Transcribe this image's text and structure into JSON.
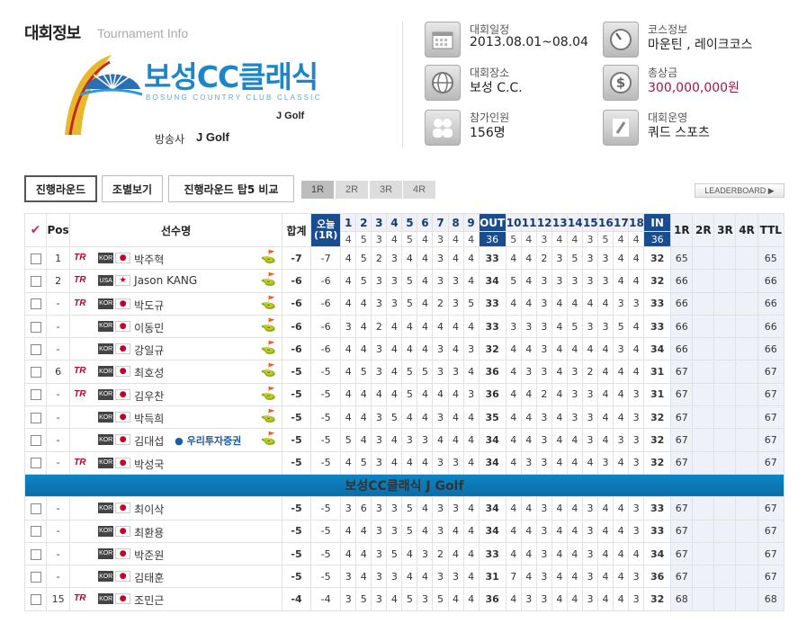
{
  "header": {
    "title": "대회정보",
    "subtitle": "Tournament Info"
  },
  "logo": {
    "name": "보성CC클래식",
    "english": "BOSUNG COUNTRY CLUB CLASSIC",
    "series": "J Golf"
  },
  "broadcast": {
    "label": "방송사",
    "logo_text": "J Golf"
  },
  "info": [
    {
      "icon": "calendar-icon",
      "label": "대회일정",
      "value": "2013.08.01~08.04"
    },
    {
      "icon": "compass-icon",
      "label": "코스정보",
      "value": "마운틴 , 레이크코스"
    },
    {
      "icon": "globe-icon",
      "label": "대회장소",
      "value": "보성 C.C."
    },
    {
      "icon": "dollar-icon",
      "label": "총상금",
      "value": "300,000,000원"
    },
    {
      "icon": "players-icon",
      "label": "참가인원",
      "value": "156명"
    },
    {
      "icon": "operator-icon",
      "label": "대회운영",
      "value": "쿼드 스포츠"
    }
  ],
  "tabs": [
    "진행라운드",
    "조별보기",
    "진행라운드 탑5 비교"
  ],
  "rounds": [
    "1R",
    "2R",
    "3R",
    "4R"
  ],
  "leaderboard_button": "LEADERBOARD ▶",
  "table": {
    "headers": {
      "pos": "Pos",
      "name": "선수명",
      "total": "합계",
      "today": "오늘(1R)",
      "out": "OUT",
      "in": "IN",
      "r1": "1R",
      "r2": "2R",
      "r3": "3R",
      "r4": "4R",
      "ttl": "TTL"
    },
    "holes": [
      "1",
      "2",
      "3",
      "4",
      "5",
      "6",
      "7",
      "8",
      "9",
      "10",
      "11",
      "12",
      "13",
      "14",
      "15",
      "16",
      "17",
      "18"
    ],
    "par": [
      4,
      5,
      3,
      4,
      5,
      4,
      3,
      4,
      4,
      5,
      4,
      3,
      4,
      4,
      3,
      5,
      4,
      4
    ],
    "par_out": "36",
    "par_in": "36",
    "rows": [
      {
        "pos": "1",
        "tr": true,
        "flag": "KOR",
        "name": "박주혁",
        "club": true,
        "total": "-7",
        "today": "-7",
        "h": [
          4,
          5,
          2,
          3,
          4,
          4,
          3,
          4,
          4
        ],
        "out": "33",
        "h2": [
          4,
          4,
          2,
          3,
          5,
          3,
          3,
          4,
          4
        ],
        "in": "32",
        "r1": "65",
        "ttl": "65"
      },
      {
        "pos": "2",
        "tr": true,
        "flag": "USA",
        "name": "Jason KANG",
        "club": true,
        "total": "-6",
        "today": "-6",
        "h": [
          4,
          5,
          3,
          3,
          5,
          4,
          3,
          3,
          4
        ],
        "out": "34",
        "h2": [
          5,
          4,
          3,
          3,
          3,
          3,
          3,
          4,
          4
        ],
        "in": "32",
        "r1": "66",
        "ttl": "66"
      },
      {
        "pos": "-",
        "tr": true,
        "flag": "KOR",
        "name": "박도규",
        "club": true,
        "total": "-6",
        "today": "-6",
        "h": [
          4,
          4,
          3,
          3,
          5,
          4,
          2,
          3,
          5
        ],
        "out": "33",
        "h2": [
          4,
          4,
          3,
          4,
          4,
          4,
          4,
          3,
          3
        ],
        "in": "33",
        "r1": "66",
        "ttl": "66"
      },
      {
        "pos": "-",
        "tr": false,
        "flag": "KOR",
        "name": "이동민",
        "club": true,
        "total": "-6",
        "today": "-6",
        "h": [
          3,
          4,
          2,
          4,
          4,
          4,
          4,
          4,
          4
        ],
        "out": "33",
        "h2": [
          3,
          3,
          3,
          4,
          5,
          3,
          3,
          5,
          4
        ],
        "in": "33",
        "r1": "66",
        "ttl": "66"
      },
      {
        "pos": "-",
        "tr": false,
        "flag": "KOR",
        "name": "강일규",
        "club": true,
        "total": "-6",
        "today": "-6",
        "h": [
          4,
          4,
          3,
          4,
          4,
          4,
          3,
          4,
          3
        ],
        "out": "32",
        "h2": [
          4,
          4,
          3,
          4,
          4,
          4,
          4,
          3,
          4
        ],
        "in": "34",
        "r1": "66",
        "ttl": "66"
      },
      {
        "pos": "6",
        "tr": true,
        "flag": "KOR",
        "name": "최호성",
        "club": true,
        "total": "-5",
        "today": "-5",
        "h": [
          4,
          5,
          3,
          4,
          5,
          5,
          3,
          3,
          4
        ],
        "out": "36",
        "h2": [
          4,
          3,
          3,
          4,
          3,
          2,
          4,
          4,
          4
        ],
        "in": "31",
        "r1": "67",
        "ttl": "67"
      },
      {
        "pos": "-",
        "tr": true,
        "flag": "KOR",
        "name": "김우찬",
        "club": true,
        "total": "-5",
        "today": "-5",
        "h": [
          4,
          4,
          4,
          4,
          5,
          4,
          4,
          4,
          3
        ],
        "out": "36",
        "h2": [
          4,
          4,
          2,
          4,
          3,
          3,
          4,
          4,
          3
        ],
        "in": "31",
        "r1": "67",
        "ttl": "67"
      },
      {
        "pos": "-",
        "tr": false,
        "flag": "KOR",
        "name": "박득희",
        "club": true,
        "total": "-5",
        "today": "-5",
        "h": [
          4,
          4,
          3,
          5,
          4,
          4,
          3,
          4,
          4
        ],
        "out": "35",
        "h2": [
          4,
          4,
          3,
          4,
          3,
          3,
          4,
          4,
          3
        ],
        "in": "32",
        "r1": "67",
        "ttl": "67"
      },
      {
        "pos": "-",
        "tr": false,
        "flag": "KOR",
        "name": "김대섭",
        "club": true,
        "sponsor": "● 우리투자증권",
        "total": "-5",
        "today": "-5",
        "h": [
          5,
          4,
          3,
          4,
          3,
          3,
          4,
          4,
          4
        ],
        "out": "34",
        "h2": [
          4,
          4,
          3,
          4,
          4,
          3,
          4,
          3,
          3
        ],
        "in": "32",
        "r1": "67",
        "ttl": "67"
      },
      {
        "pos": "-",
        "tr": true,
        "flag": "KOR",
        "name": "박성국",
        "club": false,
        "total": "-5",
        "today": "-5",
        "h": [
          4,
          5,
          3,
          4,
          4,
          4,
          3,
          3,
          4
        ],
        "out": "34",
        "h2": [
          4,
          3,
          3,
          4,
          4,
          4,
          3,
          4,
          3
        ],
        "in": "32",
        "r1": "67",
        "ttl": "67"
      }
    ],
    "banner": "보성CC클래식 J Golf",
    "rows2": [
      {
        "pos": "-",
        "tr": false,
        "flag": "KOR",
        "name": "최이삭",
        "club": false,
        "total": "-5",
        "today": "-5",
        "h": [
          3,
          6,
          3,
          3,
          5,
          4,
          3,
          3,
          4
        ],
        "out": "34",
        "h2": [
          4,
          4,
          3,
          4,
          4,
          3,
          4,
          4,
          3
        ],
        "in": "33",
        "r1": "67",
        "ttl": "67"
      },
      {
        "pos": "-",
        "tr": false,
        "flag": "KOR",
        "name": "최환용",
        "club": false,
        "total": "-5",
        "today": "-5",
        "h": [
          4,
          4,
          3,
          3,
          5,
          4,
          3,
          4,
          4
        ],
        "out": "34",
        "h2": [
          4,
          4,
          3,
          4,
          4,
          3,
          4,
          4,
          3
        ],
        "in": "33",
        "r1": "67",
        "ttl": "67"
      },
      {
        "pos": "-",
        "tr": false,
        "flag": "KOR",
        "name": "박준원",
        "club": false,
        "total": "-5",
        "today": "-5",
        "h": [
          4,
          4,
          3,
          5,
          4,
          3,
          2,
          4,
          4
        ],
        "out": "33",
        "h2": [
          4,
          4,
          3,
          4,
          4,
          3,
          4,
          4,
          4
        ],
        "in": "34",
        "r1": "67",
        "ttl": "67"
      },
      {
        "pos": "-",
        "tr": false,
        "flag": "KOR",
        "name": "김태훈",
        "club": false,
        "total": "-5",
        "today": "-5",
        "h": [
          3,
          4,
          3,
          3,
          4,
          4,
          3,
          3,
          4
        ],
        "out": "31",
        "h2": [
          7,
          4,
          3,
          4,
          4,
          3,
          4,
          4,
          3
        ],
        "in": "36",
        "r1": "67",
        "ttl": "67"
      },
      {
        "pos": "15",
        "tr": true,
        "flag": "KOR",
        "name": "조민근",
        "club": false,
        "total": "-4",
        "today": "-4",
        "h": [
          3,
          5,
          3,
          4,
          5,
          3,
          5,
          4,
          4
        ],
        "out": "36",
        "h2": [
          4,
          3,
          3,
          4,
          4,
          3,
          4,
          4,
          3
        ],
        "in": "32",
        "r1": "68",
        "ttl": "68"
      }
    ]
  }
}
